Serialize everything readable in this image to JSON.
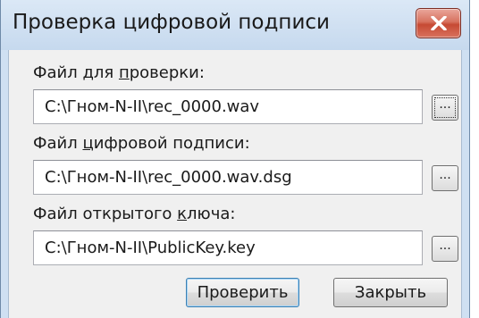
{
  "dialog": {
    "title": "Проверка цифровой подписи",
    "close_label": "✕"
  },
  "fields": [
    {
      "label_before": "Файл для ",
      "label_mnemonic": "п",
      "label_after": "роверки:",
      "value": "C:\\Гном-N-II\\rec_0000.wav",
      "browse_label": "..."
    },
    {
      "label_before": "Файл ",
      "label_mnemonic": "ц",
      "label_after": "ифровой подписи:",
      "value": "C:\\Гном-N-II\\rec_0000.wav.dsg",
      "browse_label": "..."
    },
    {
      "label_before": "Файл открытого ",
      "label_mnemonic": "к",
      "label_after": "лю­ча:",
      "value": "C:\\Гном-N-II\\PublicKey.key",
      "browse_label": "..."
    }
  ],
  "buttons": {
    "verify_label": "Проверить",
    "close_label": "Закрыть"
  }
}
